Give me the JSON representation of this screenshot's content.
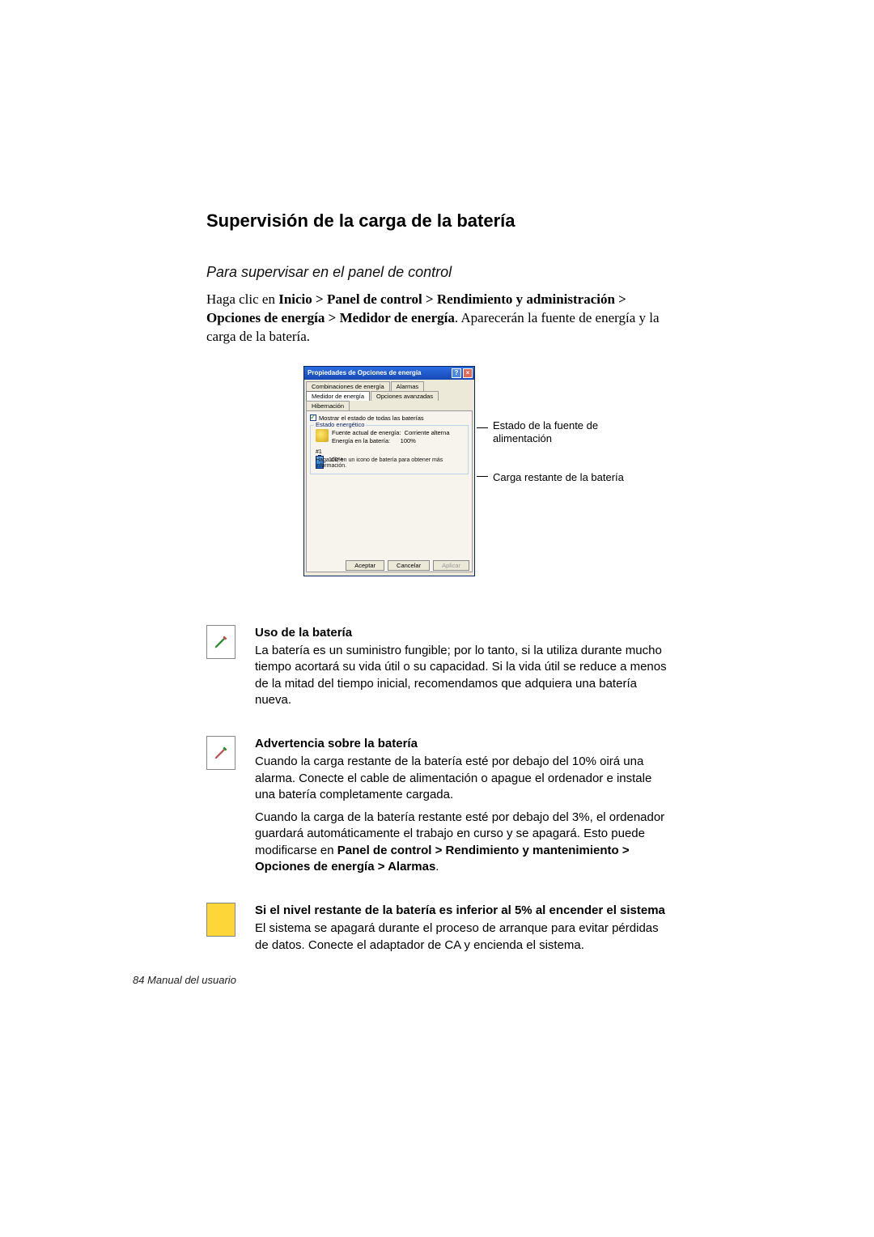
{
  "headings": {
    "h1": "Supervisión de la carga de la batería",
    "h2": "Para supervisar en el panel de control"
  },
  "intro": {
    "pre": "Haga clic en ",
    "bold": "Inicio > Panel de control > Rendimiento y administración > Opciones de energía > Medidor de energía",
    "post": ". Aparecerán la fuente de energía y la carga de la batería."
  },
  "dialog": {
    "title": "Propiedades de Opciones de energía",
    "tabs": {
      "t1": "Combinaciones de energía",
      "t2": "Alarmas",
      "t3": "Medidor de energía",
      "t4": "Opciones avanzadas",
      "t5": "Hibernación"
    },
    "check": "Mostrar el estado de todas las baterías",
    "group_legend": "Estado energético",
    "row1a": "Fuente actual de energía:",
    "row1b": "Corriente alterna",
    "row2a": "Energía en la batería:",
    "row2b": "100%",
    "battery_num": "#1",
    "battery_pct": "100%",
    "hint": "Haga clic en un icono de batería para obtener más información.",
    "btn_ok": "Aceptar",
    "btn_cancel": "Cancelar",
    "btn_apply": "Aplicar"
  },
  "callouts": {
    "c1": "Estado de la fuente de alimentación",
    "c2": "Carga restante de la batería"
  },
  "notes": {
    "n1_title": "Uso de la batería",
    "n1_body": "La batería es un suministro fungible; por lo tanto, si la utiliza durante mucho tiempo acortará su vida útil o su capacidad. Si la vida útil se reduce a menos de la mitad del tiempo inicial, recomendamos que adquiera una batería nueva.",
    "n2_title": "Advertencia sobre la batería",
    "n2_p1": "Cuando la carga restante de la batería esté por debajo del 10% oirá una alarma. Conecte el cable de alimentación o apague el ordenador e instale una batería completamente cargada.",
    "n2_p2_pre": "Cuando la carga de la batería restante esté por debajo del 3%, el ordenador guardará automáticamente el trabajo en curso y se apagará. Esto puede modificarse en ",
    "n2_p2_bold": "Panel de control > Rendimiento y mantenimiento > Opciones de energía > Alarmas",
    "n2_p2_post": ".",
    "n3_title": "Si el nivel restante de la batería es inferior al 5% al encender el sistema",
    "n3_body": "El sistema se apagará durante el proceso de arranque para evitar pérdidas de datos. Conecte el adaptador de CA y encienda el sistema."
  },
  "footer": "84  Manual del usuario"
}
